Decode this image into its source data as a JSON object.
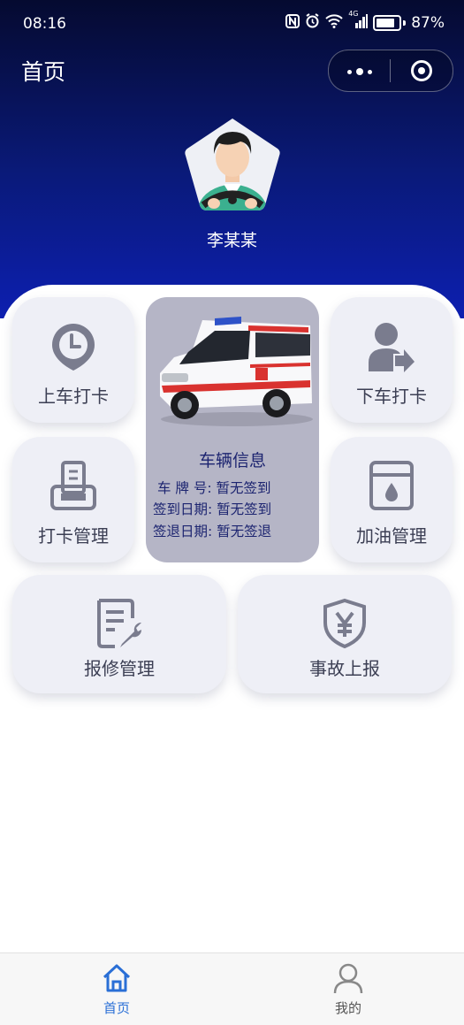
{
  "status": {
    "time": "08:16",
    "battery": "87%",
    "network": "4G"
  },
  "nav": {
    "title": "首页"
  },
  "user": {
    "name": "李某某"
  },
  "cards": {
    "board_checkin": "上车打卡",
    "alight_checkin": "下车打卡",
    "checkin_manage": "打卡管理",
    "refuel_manage": "加油管理",
    "repair_manage": "报修管理",
    "accident_report": "事故上报"
  },
  "vehicle": {
    "title": "车辆信息",
    "plate_label": "车 牌 号:",
    "plate_value": "暂无签到",
    "signin_label": "签到日期:",
    "signin_value": "暂无签到",
    "signout_label": "签退日期:",
    "signout_value": "暂无签退"
  },
  "tabbar": {
    "home": "首页",
    "mine": "我的",
    "active_color": "#2a6fd6",
    "inactive_color": "#555555"
  },
  "colors": {
    "header_top": "#050a30",
    "header_bottom": "#0d1fb0",
    "card_bg": "#eeeff6",
    "icon_gray": "#7a7c8e"
  }
}
